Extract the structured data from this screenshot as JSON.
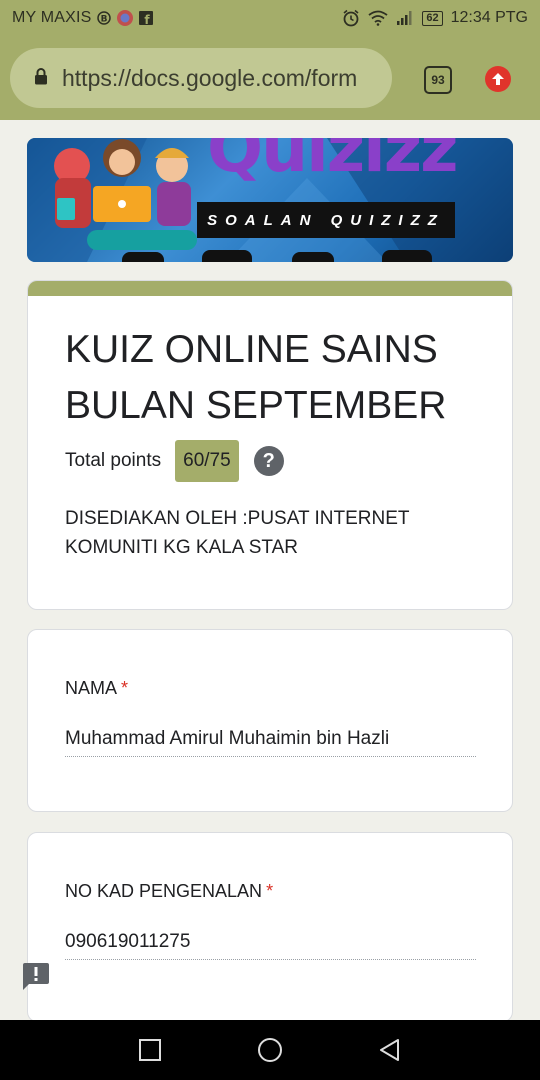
{
  "status_bar": {
    "carrier": "MY MAXIS",
    "battery": "62",
    "time": "12:34 PTG"
  },
  "browser": {
    "url": "https://docs.google.com/form",
    "tab_count": "93",
    "accent_color": "#a4ad6a"
  },
  "banner": {
    "title": "Quizizz",
    "strip_text": "SOALAN QUIZIZZ"
  },
  "form": {
    "title": "KUIZ ONLINE SAINS BULAN SEPTEMBER",
    "total_points_label": "Total points",
    "score": "60/75",
    "help_icon": "?",
    "description": "DISEDIAKAN OLEH :PUSAT INTERNET KOMUNITI KG KALA STAR"
  },
  "questions": [
    {
      "label": "NAMA",
      "required_mark": "*",
      "answer": "Muhammad Amirul Muhaimin bin Hazli"
    },
    {
      "label": "NO KAD PENGENALAN",
      "required_mark": "*",
      "answer": "090619011275"
    }
  ],
  "icons": {
    "feedback": "feedback-icon",
    "nav": [
      "recent-apps-icon",
      "home-icon",
      "back-icon"
    ]
  }
}
